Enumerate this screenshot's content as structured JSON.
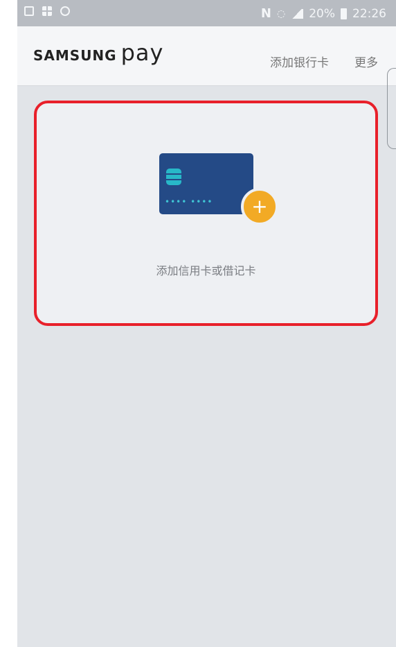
{
  "status_bar": {
    "battery": "20%",
    "time": "22:26",
    "icons": [
      "image-icon",
      "grid-icon",
      "blocked-icon",
      "nfc-icon",
      "wifi-icon",
      "signal-icon",
      "battery-icon"
    ]
  },
  "app_bar": {
    "logo_samsung": "SAMSUNG",
    "logo_pay": "pay",
    "add_bank_card": "添加银行卡",
    "more": "更多"
  },
  "card_prompt": {
    "dots": "•••• ••••",
    "plus": "+",
    "label": "添加信用卡或借记卡"
  },
  "colors": {
    "highlight_border": "#e8202a",
    "card_blue": "#244a86",
    "chip_teal": "#28b8c8",
    "plus_orange": "#f2aa25"
  }
}
